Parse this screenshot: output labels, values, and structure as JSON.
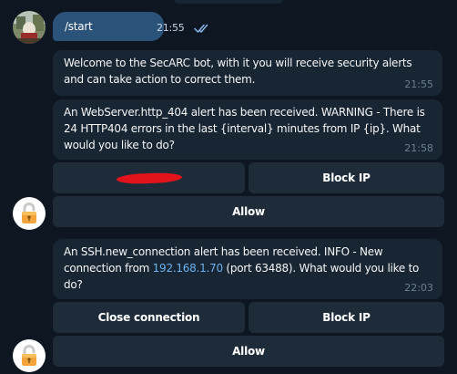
{
  "outgoing": {
    "text": "/start",
    "time": "21:55",
    "status": "read"
  },
  "messages": [
    {
      "lines": [
        "Welcome to the SecARC bot, with it you will receive security alerts",
        "and can take action to correct them."
      ],
      "time": "21:55"
    },
    {
      "lines": [
        "An WebServer.http_404 alert has been received. WARNING - There is",
        "24 HTTP404 errors in the last {interval} minutes from IP {ip}. What",
        "would you like to do?"
      ],
      "time": "21:58"
    },
    {
      "line1": "An SSH.new_connection alert has been received. INFO - New",
      "line2_pre": "connection from ",
      "line2_link": "192.168.1.70",
      "line2_post": " (port 63488). What would you like to",
      "line3": "do?",
      "time": "22:03"
    }
  ],
  "keyboard1": {
    "redacted_label": "",
    "block_label": "Block IP",
    "allow_label": "Allow"
  },
  "keyboard2": {
    "close_label": "Close connection",
    "block_label": "Block IP",
    "allow_label": "Allow"
  },
  "icons": {
    "user_avatar": "user-avatar",
    "bot_avatar": "open-padlock-icon",
    "read_ticks": "double-check-icon"
  },
  "colors": {
    "background": "#0e1621",
    "incoming_bubble": "#182533",
    "outgoing_bubble": "#2b5278",
    "button": "#1e2c3a",
    "link": "#6ab2f2",
    "redaction": "#e3131b"
  }
}
